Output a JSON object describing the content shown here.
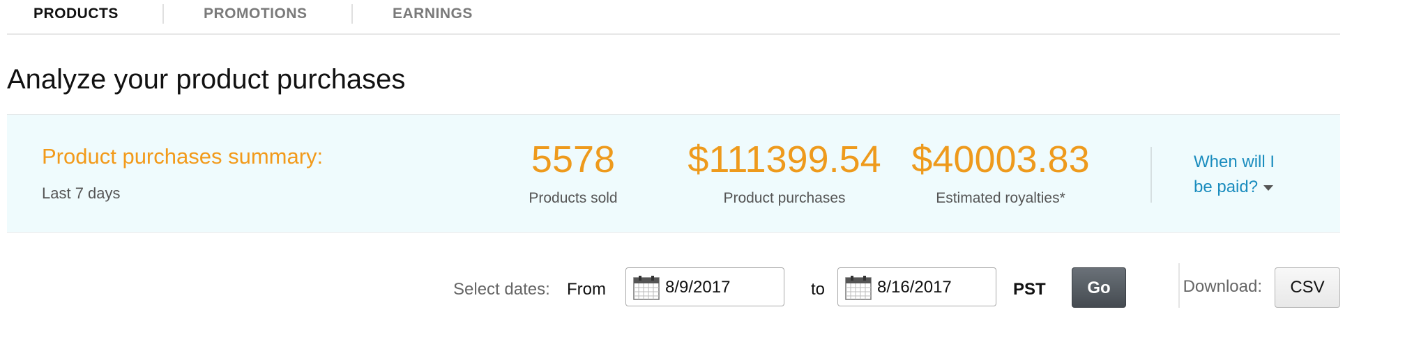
{
  "tabs": [
    {
      "label": "PRODUCTS",
      "active": true
    },
    {
      "label": "PROMOTIONS",
      "active": false
    },
    {
      "label": "EARNINGS",
      "active": false
    }
  ],
  "page_title": "Analyze your product purchases",
  "summary": {
    "heading": "Product purchases summary:",
    "period": "Last 7 days",
    "metrics": [
      {
        "value": "5578",
        "label": "Products sold"
      },
      {
        "value": "$111399.54",
        "label": "Product purchases"
      },
      {
        "value": "$40003.83",
        "label": "Estimated royalties*"
      }
    ],
    "when_paid": {
      "line1": "When will I",
      "line2": "be paid?"
    }
  },
  "dates": {
    "select_label": "Select dates:",
    "from_label": "From",
    "from_value": "8/9/2017",
    "to_label": "to",
    "to_value": "8/16/2017",
    "timezone": "PST",
    "go_label": "Go"
  },
  "download": {
    "label": "Download:",
    "csv_label": "CSV"
  },
  "colors": {
    "accent_orange": "#f29a1a",
    "link_blue": "#1a8cbe",
    "summary_bg": "#effbfd"
  },
  "icons": [
    "calendar-icon",
    "caret-down-icon"
  ]
}
